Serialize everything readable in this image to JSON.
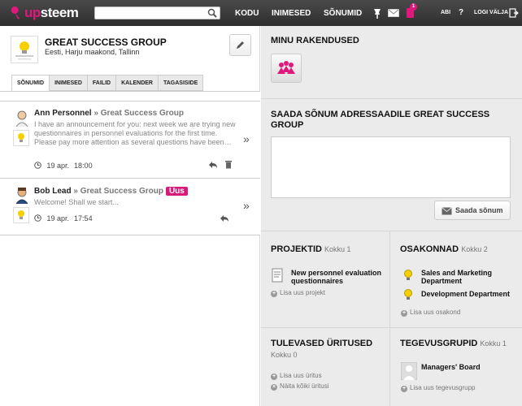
{
  "brand": {
    "logo_up": "up",
    "logo_rest": "steem",
    "accent": "#e0187b"
  },
  "search": {
    "placeholder": "",
    "value": ""
  },
  "nav": {
    "home": "KODU",
    "people": "INIMESED",
    "messages": "SÕNUMID",
    "notification_count": "1",
    "help": "ABI",
    "help_q": "?",
    "logout": "LOGI VÄLJA"
  },
  "group": {
    "name": "GREAT SUCCESS GROUP",
    "location": "Eesti, Harju maakond, Tallinn"
  },
  "tabs": [
    {
      "label": "SÕNUMID",
      "active": true
    },
    {
      "label": "INIMESED",
      "active": false
    },
    {
      "label": "FAILID",
      "active": false
    },
    {
      "label": "KALENDER",
      "active": false
    },
    {
      "label": "TAGASISIDE",
      "active": false
    }
  ],
  "messages": [
    {
      "author": "Ann Personnel",
      "separator": " » ",
      "group": "Great Success Group",
      "badge": "",
      "body": "I have an announcement for you: next week we are trying new questionnaires in personnel evaluations for the first time. Please pay more attention as several questions have been…",
      "date": "19 apr.",
      "time": "18:00",
      "more": "»"
    },
    {
      "author": "Bob Lead",
      "separator": " » ",
      "group": "Great Success Group",
      "badge": "Uus",
      "body": "Welcome! Shall we start...",
      "date": "19 apr.",
      "time": "17:54",
      "more": "»"
    }
  ],
  "apps": {
    "title": "MINU RAKENDUSED",
    "icon": "group-app-icon"
  },
  "send": {
    "title": "SAADA SÕNUM ADRESSAADILE GREAT SUCCESS GROUP",
    "textarea_value": "",
    "button": "Saada sõnum"
  },
  "projects": {
    "title": "PROJEKTID",
    "count": "Kokku 1",
    "items": [
      {
        "name": "New personnel evaluation questionnaires"
      }
    ],
    "add": "Lisa uus projekt"
  },
  "departments": {
    "title": "OSAKONNAD",
    "count": "Kokku 2",
    "items": [
      {
        "name": "Sales and Marketing Department"
      },
      {
        "name": "Development Department"
      }
    ],
    "add": "Lisa uus osakond"
  },
  "events": {
    "title": "TULEVASED ÜRITUSED",
    "count": "Kokku 0",
    "add": "Lisa uus üritus",
    "show_all": "Näita kõiki üritusi"
  },
  "activity_groups": {
    "title": "TEGEVUSGRUPID",
    "count": "Kokku 1",
    "items": [
      {
        "name": "Managers' Board"
      }
    ],
    "add": "Lisa uus tegevusgrupp"
  }
}
